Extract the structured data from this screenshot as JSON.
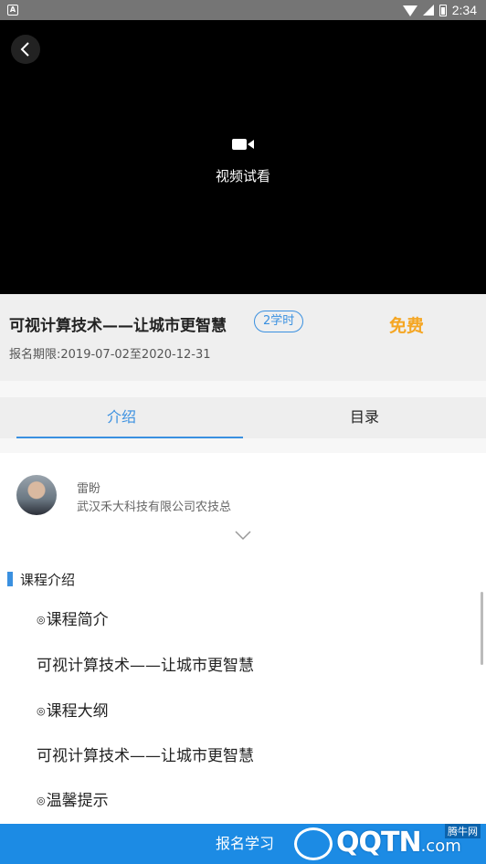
{
  "status_bar": {
    "time": "2:34",
    "left_icon_letter": "A",
    "icons": [
      "wifi-icon",
      "signal-icon",
      "battery-icon"
    ]
  },
  "video": {
    "label": "视频试看",
    "icon": "video-camera-icon",
    "back_icon": "back-chevron-icon"
  },
  "course": {
    "title": "可视计算技术——让城市更智慧",
    "hours_badge": "2学时",
    "price": "免费",
    "enroll_period": "报名期限:2019-07-02至2020-12-31"
  },
  "tabs": [
    {
      "label": "介绍",
      "active": true
    },
    {
      "label": "目录",
      "active": false
    }
  ],
  "teacher": {
    "name": "雷盼",
    "org": "武汉禾大科技有限公司农技总"
  },
  "intro": {
    "section_title": "课程介绍",
    "bullet": "◎",
    "lines": [
      {
        "text": "课程简介",
        "bulleted": true
      },
      {
        "text": "可视计算技术——让城市更智慧",
        "bulleted": false
      },
      {
        "text": "课程大纲",
        "bulleted": true
      },
      {
        "text": "可视计算技术——让城市更智慧",
        "bulleted": false
      },
      {
        "text": "温馨提示",
        "bulleted": true
      }
    ]
  },
  "bottom": {
    "enroll_label": "报名学习"
  },
  "watermark": {
    "brand": "QQTN",
    "suffix": ".com",
    "cn": "腾牛网"
  },
  "colors": {
    "accent": "#3a90e0",
    "price": "#f5a623",
    "bottom_bar": "#1c8be4"
  }
}
